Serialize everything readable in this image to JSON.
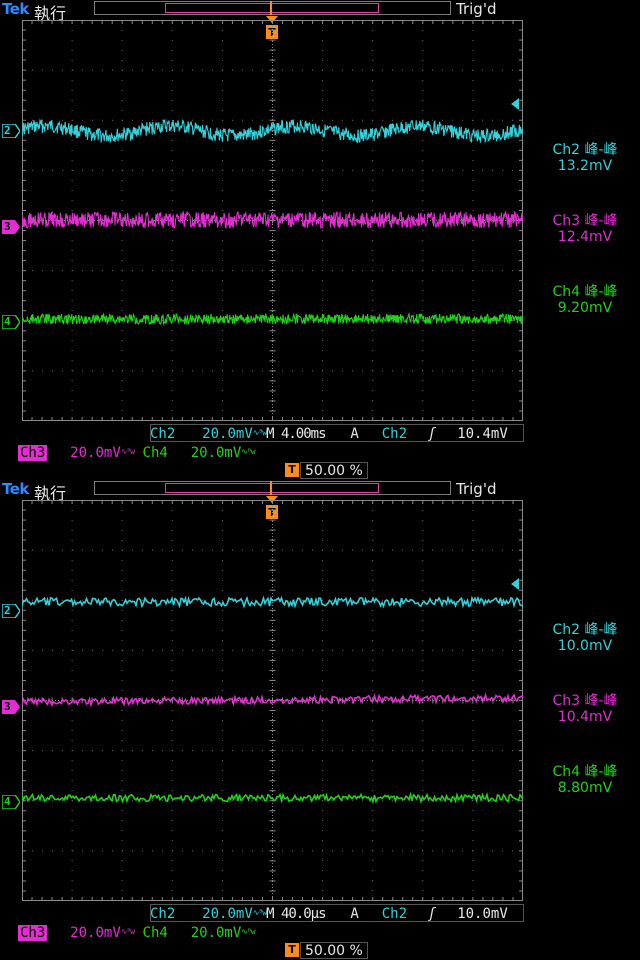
{
  "colors": {
    "ch2": "#35d0d8",
    "ch3": "#e22ed0",
    "ch4": "#22d11a",
    "trigger": "#ff8c1a",
    "brand": "#2e8bff"
  },
  "screens": [
    {
      "brand": "Tek",
      "run_state": "執行",
      "trig_status": "Trig'd",
      "ch_markers": [
        "2",
        "3",
        "4"
      ],
      "measurements": [
        {
          "label": "Ch2 峰-峰",
          "value": "13.2mV"
        },
        {
          "label": "Ch3 峰-峰",
          "value": "12.4mV"
        },
        {
          "label": "Ch4 峰-峰",
          "value": "9.20mV"
        }
      ],
      "ch2_name": "Ch2",
      "ch2_scale": "20.0mV",
      "bw_icon": "∿ᴮw",
      "timebase": "M 4.00ms",
      "trigger_mode": "A",
      "trigger_source": "Ch2",
      "trigger_slope_icon": "rising-edge-icon",
      "trigger_slope_glyph": "ʃ",
      "trigger_level": "10.4mV",
      "ch3_name": "Ch3",
      "ch3_scale": "20.0mV",
      "ch4_name": "Ch4",
      "ch4_scale": "20.0mV",
      "trigger_icon_letter": "T",
      "trigger_position": "50.00 %"
    },
    {
      "brand": "Tek",
      "run_state": "執行",
      "trig_status": "Trig'd",
      "ch_markers": [
        "2",
        "3",
        "4"
      ],
      "measurements": [
        {
          "label": "Ch2 峰-峰",
          "value": "10.0mV"
        },
        {
          "label": "Ch3 峰-峰",
          "value": "10.4mV"
        },
        {
          "label": "Ch4 峰-峰",
          "value": "8.80mV"
        }
      ],
      "ch2_name": "Ch2",
      "ch2_scale": "20.0mV",
      "bw_icon": "∿ᴮw",
      "timebase": "M 40.0µs",
      "trigger_mode": "A",
      "trigger_source": "Ch2",
      "trigger_slope_icon": "rising-edge-icon",
      "trigger_slope_glyph": "ʃ",
      "trigger_level": "10.0mV",
      "ch3_name": "Ch3",
      "ch3_scale": "20.0mV",
      "ch4_name": "Ch4",
      "ch4_scale": "20.0mV",
      "trigger_icon_letter": "T",
      "trigger_position": "50.00 %"
    }
  ]
}
